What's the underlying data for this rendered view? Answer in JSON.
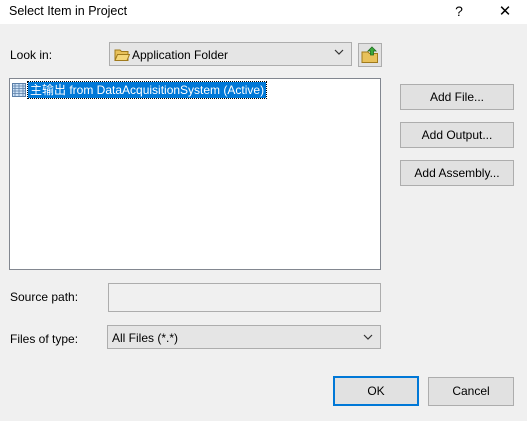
{
  "window": {
    "title": "Select Item in Project",
    "help_label": "?",
    "close_label": "✕"
  },
  "look_in": {
    "label": "Look in:",
    "value": "Application Folder",
    "icon": "folder-open-icon",
    "up_icon": "up-one-level-icon"
  },
  "file_list": {
    "items": [
      {
        "label": "主输出 from DataAcquisitionSystem (Active)",
        "icon": "project-output-icon",
        "selected": true
      }
    ]
  },
  "actions": {
    "add_file": "Add File...",
    "add_output": "Add Output...",
    "add_assembly": "Add Assembly..."
  },
  "source_path": {
    "label": "Source path:",
    "value": ""
  },
  "files_of_type": {
    "label": "Files of type:",
    "value": "All Files (*.*)"
  },
  "footer": {
    "ok": "OK",
    "cancel": "Cancel"
  },
  "colors": {
    "selection": "#0078d7",
    "primary_border": "#0078d7",
    "dialog_bg": "#f0f0f0"
  }
}
